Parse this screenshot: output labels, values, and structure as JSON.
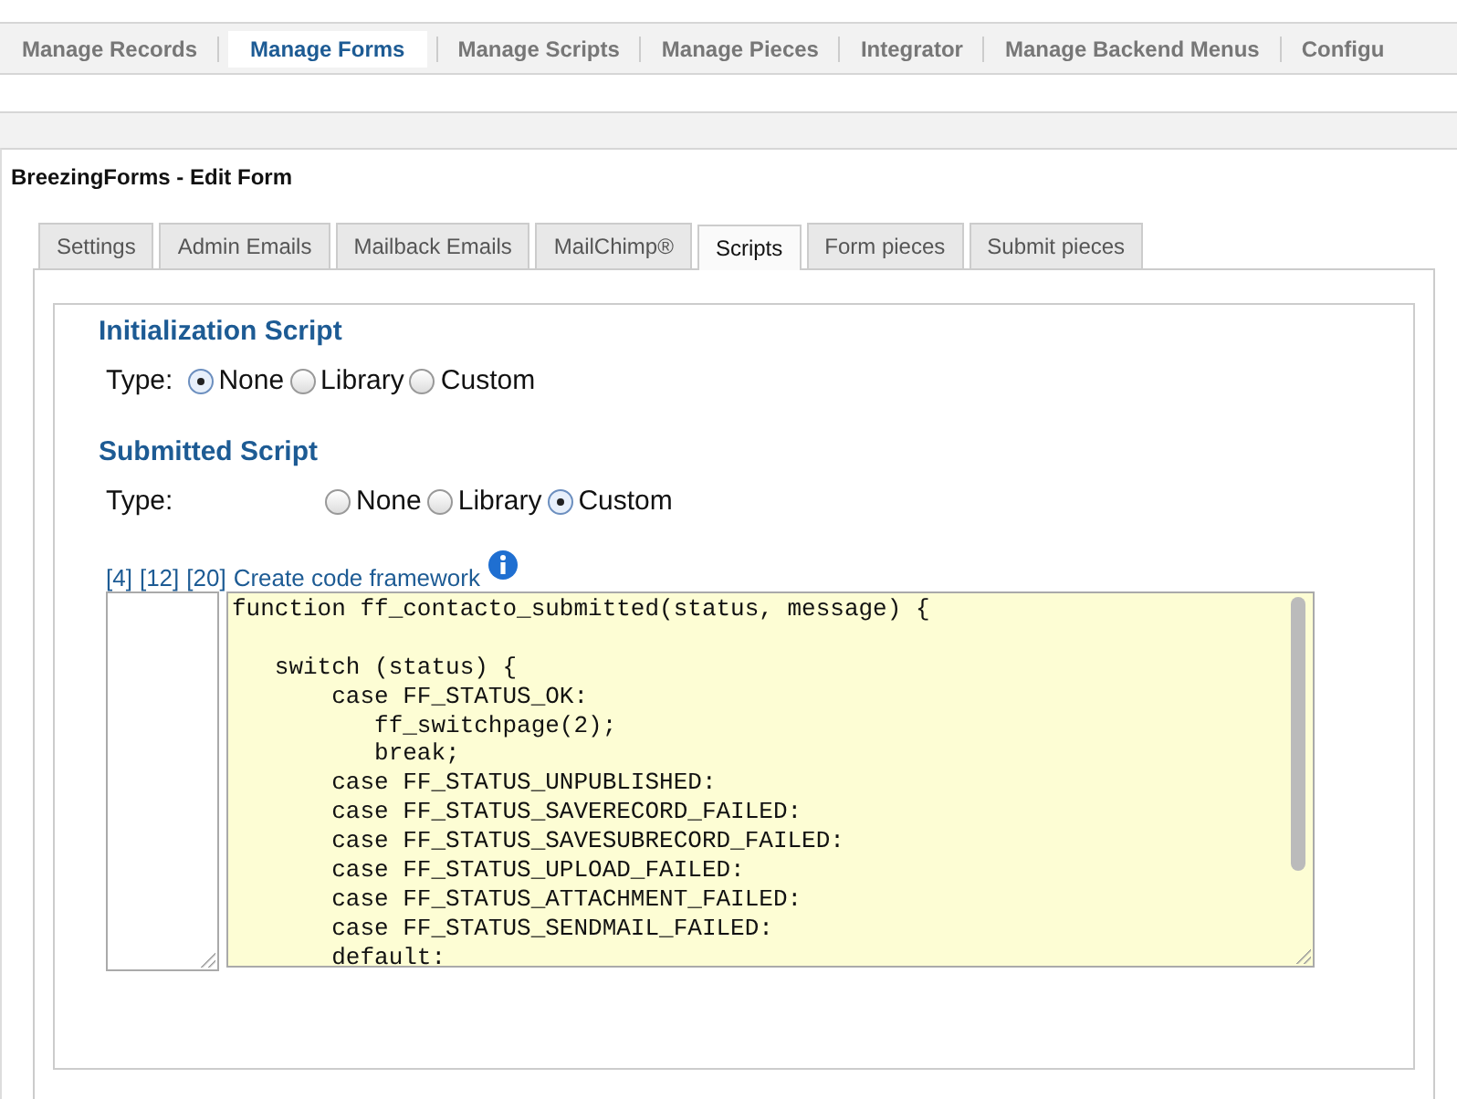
{
  "top_menu": [
    {
      "label": "Manage Records",
      "selected": false
    },
    {
      "label": "Manage Forms",
      "selected": true
    },
    {
      "label": "Manage Scripts",
      "selected": false
    },
    {
      "label": "Manage Pieces",
      "selected": false
    },
    {
      "label": "Integrator",
      "selected": false
    },
    {
      "label": "Manage Backend Menus",
      "selected": false
    },
    {
      "label": "Configu",
      "selected": false
    }
  ],
  "page_title": "BreezingForms - Edit Form",
  "tabs": [
    {
      "label": "Settings",
      "selected": false
    },
    {
      "label": "Admin Emails",
      "selected": false
    },
    {
      "label": "Mailback Emails",
      "selected": false
    },
    {
      "label": "MailChimp®",
      "selected": false
    },
    {
      "label": "Scripts",
      "selected": true
    },
    {
      "label": "Form pieces",
      "selected": false
    },
    {
      "label": "Submit pieces",
      "selected": false
    }
  ],
  "sections": [
    {
      "title": "Initialization Script",
      "type_label": "Type:",
      "wide": false,
      "options": [
        {
          "label": "None",
          "selected": true
        },
        {
          "label": "Library",
          "selected": false
        },
        {
          "label": "Custom",
          "selected": false
        }
      ]
    },
    {
      "title": "Submitted Script",
      "type_label": "Type:",
      "wide": true,
      "options": [
        {
          "label": "None",
          "selected": false
        },
        {
          "label": "Library",
          "selected": false
        },
        {
          "label": "Custom",
          "selected": true
        }
      ],
      "links": [
        "[4]",
        "[12]",
        "[20]",
        "Create code framework"
      ],
      "code_blocks": [
        [
          "function ff_contacto_submitted(status, message) {"
        ],
        [
          "   switch (status) {",
          "       case FF_STATUS_OK:",
          "          ff_switchpage(2);",
          "          break;",
          "       case FF_STATUS_UNPUBLISHED:",
          "       case FF_STATUS_SAVERECORD_FAILED:",
          "       case FF_STATUS_SAVESUBRECORD_FAILED:",
          "       case FF_STATUS_UPLOAD_FAILED:",
          "       case FF_STATUS_ATTACHMENT_FAILED:",
          "       case FF_STATUS_SENDMAIL_FAILED:",
          "       default:"
        ]
      ]
    }
  ]
}
